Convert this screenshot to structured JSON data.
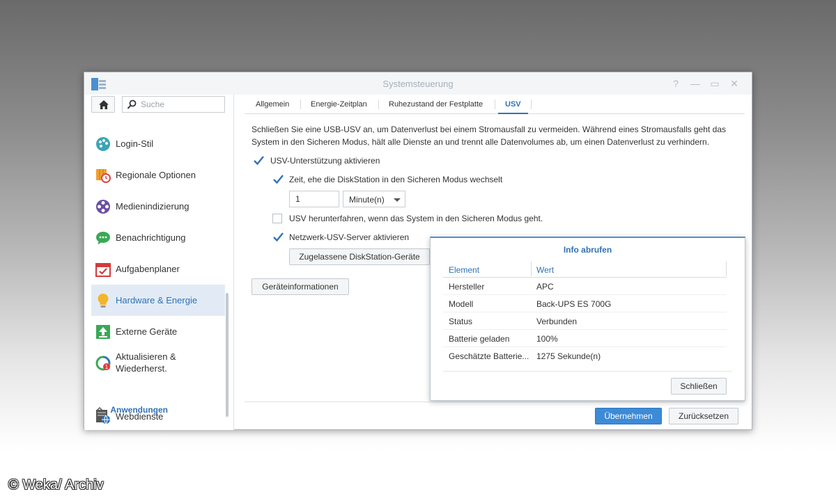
{
  "window": {
    "title": "Systemsteuerung",
    "controls": {
      "help": "?",
      "minimize": "—",
      "maximize": "▭",
      "close": "✕"
    }
  },
  "sidebar": {
    "search_placeholder": "Suche",
    "items": [
      {
        "label": "Login-Stil",
        "icon": "palette-icon"
      },
      {
        "label": "Regionale Optionen",
        "icon": "map-clock-icon"
      },
      {
        "label": "Medienindizierung",
        "icon": "film-reel-icon"
      },
      {
        "label": "Benachrichtigung",
        "icon": "chat-bubble-icon"
      },
      {
        "label": "Aufgabenplaner",
        "icon": "calendar-check-icon"
      },
      {
        "label": "Hardware & Energie",
        "icon": "lightbulb-icon",
        "active": true
      },
      {
        "label": "Externe Geräte",
        "icon": "upload-icon"
      },
      {
        "label_line1": "Aktualisieren &",
        "label_line2": "Wiederherst.",
        "icon": "refresh-icon",
        "badge": "1"
      },
      {
        "label": "Webdienste",
        "icon": "web-services-icon"
      }
    ],
    "section_header": "Anwendungen"
  },
  "tabs": [
    {
      "label": "Allgemein"
    },
    {
      "label": "Energie-Zeitplan"
    },
    {
      "label": "Ruhezustand der Festplatte"
    },
    {
      "label": "USV",
      "active": true
    }
  ],
  "content": {
    "description": "Schließen Sie eine USB-USV an, um Datenverlust bei einem Stromausfall zu vermeiden. Während eines Stromausfalls geht das System in den Sicheren Modus, hält alle Dienste an und trennt alle Datenvolumes ab, um einen Datenverlust zu verhindern.",
    "enable_ups": {
      "label": "USV-Unterstützung aktivieren",
      "checked": true
    },
    "time_before_safe": {
      "label": "Zeit, ehe die DiskStation in den Sicheren Modus wechselt",
      "checked": true
    },
    "time_value": "1",
    "time_unit": "Minute(n)",
    "shutdown_ups": {
      "label": "USV herunterfahren, wenn das System in den Sicheren Modus geht.",
      "checked": false
    },
    "network_ups": {
      "label": "Netzwerk-USV-Server aktivieren",
      "checked": true
    },
    "allowed_devices_button": "Zugelassene DiskStation-Geräte",
    "device_info_button": "Geräteinformationen"
  },
  "footer": {
    "apply_button": "Übernehmen",
    "reset_button": "Zurücksetzen"
  },
  "dialog": {
    "title": "Info abrufen",
    "columns": [
      "Element",
      "Wert"
    ],
    "rows": [
      {
        "element": "Hersteller",
        "value": "APC"
      },
      {
        "element": "Modell",
        "value": "Back-UPS ES 700G"
      },
      {
        "element": "Status",
        "value": "Verbunden"
      },
      {
        "element": "Batterie geladen",
        "value": "100%"
      },
      {
        "element": "Geschätzte Batterie...",
        "value": "1275 Sekunde(n)"
      }
    ],
    "close_button": "Schließen"
  },
  "watermark": "© Weka/ Archiv",
  "colors": {
    "accent": "#2f72b6",
    "primary_button": "#3d8ad6",
    "active_nav_bg": "#e2ebf5"
  }
}
